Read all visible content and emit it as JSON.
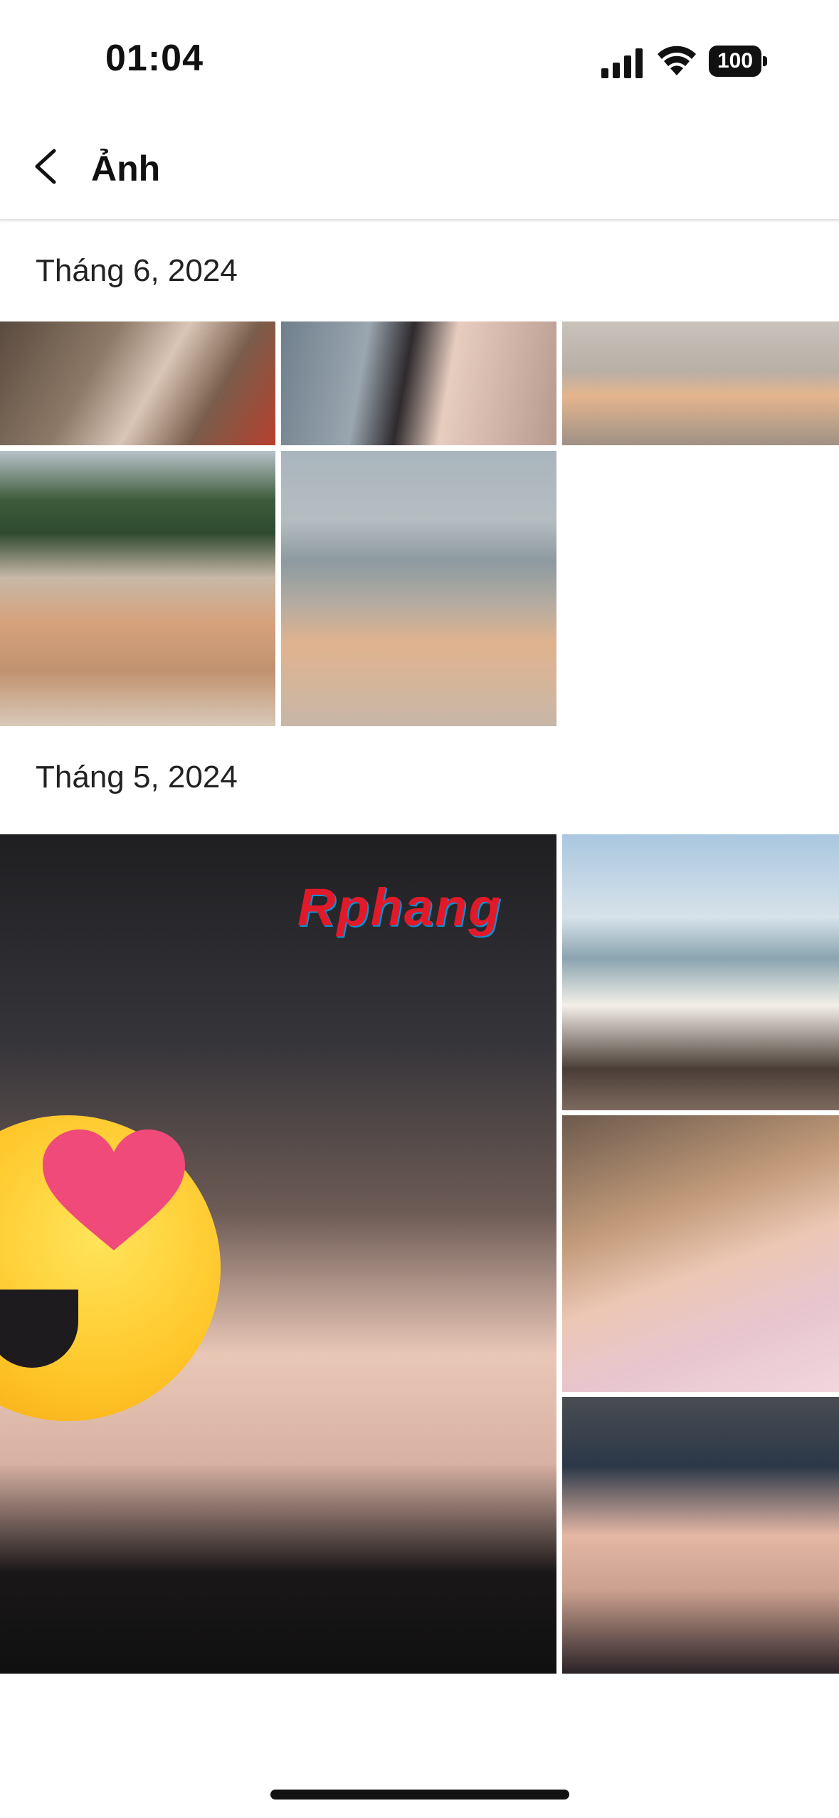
{
  "status_bar": {
    "time": "01:04",
    "battery": "100"
  },
  "header": {
    "title": "Ảnh",
    "back_icon": "chevron-left-icon"
  },
  "sections": [
    {
      "label": "Tháng 6, 2024"
    },
    {
      "label": "Tháng 5, 2024"
    }
  ],
  "watermark": "Rphang",
  "colors": {
    "background": "#ffffff",
    "text": "#111111",
    "divider": "#e2e2e2"
  }
}
